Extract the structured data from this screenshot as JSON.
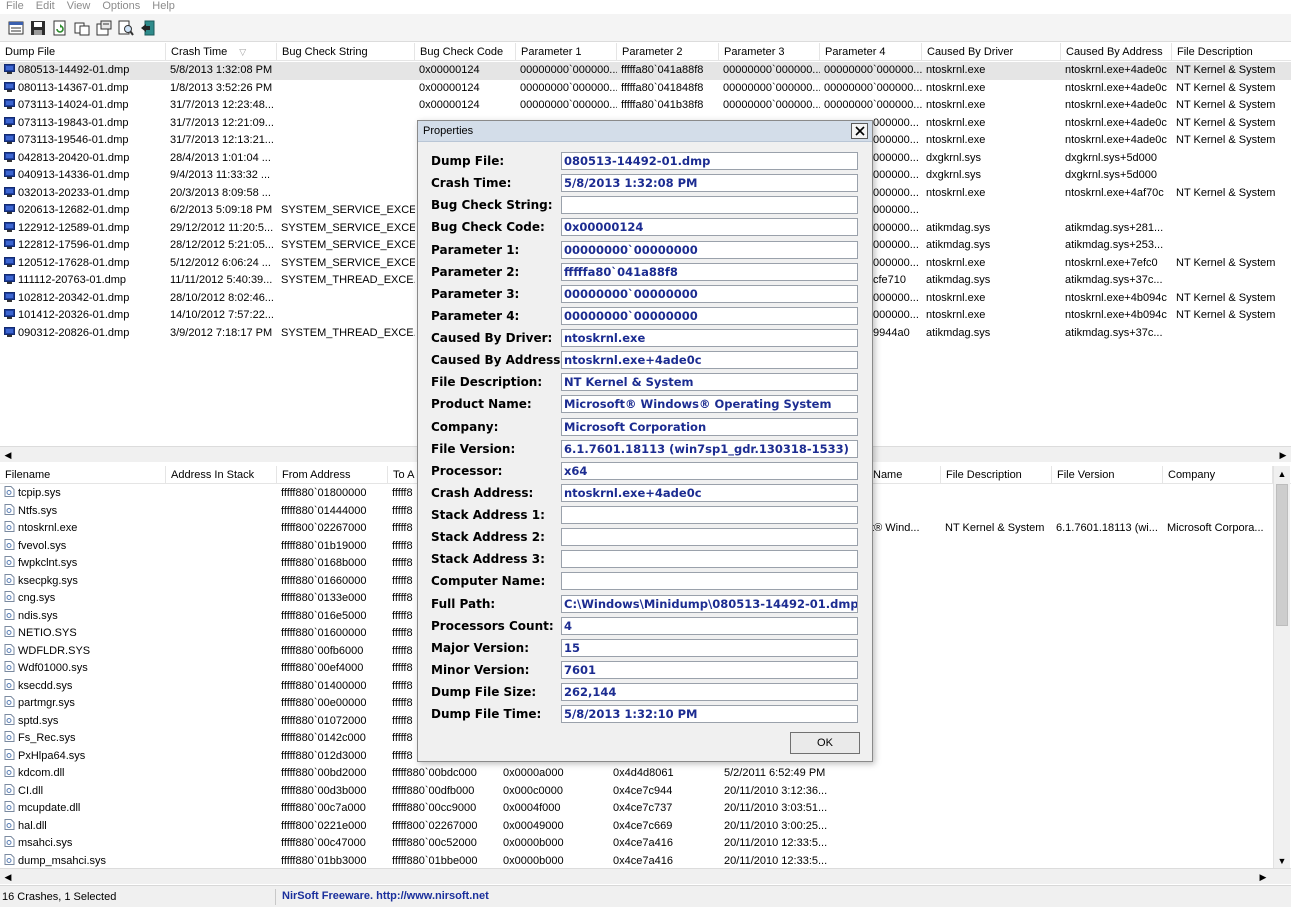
{
  "menu": [
    "File",
    "Edit",
    "View",
    "Options",
    "Help"
  ],
  "toolbar": {
    "icons": [
      "properties-icon",
      "save-icon",
      "refresh-icon",
      "copy-icon",
      "html-report-icon",
      "find-icon",
      "exit-icon"
    ]
  },
  "top_table": {
    "columns": [
      "Dump File",
      "Crash Time",
      "Bug Check String",
      "Bug Check Code",
      "Parameter 1",
      "Parameter 2",
      "Parameter 3",
      "Parameter 4",
      "Caused By Driver",
      "Caused By Address",
      "File Description"
    ],
    "sort_column": "Crash Time",
    "rows": [
      [
        "080513-14492-01.dmp",
        "5/8/2013 1:32:08 PM",
        "",
        "0x00000124",
        "00000000`000000...",
        "fffffa80`041a88f8",
        "00000000`000000...",
        "00000000`000000...",
        "ntoskrnl.exe",
        "ntoskrnl.exe+4ade0c",
        "NT Kernel & System"
      ],
      [
        "080113-14367-01.dmp",
        "1/8/2013 3:52:26 PM",
        "",
        "0x00000124",
        "00000000`000000...",
        "fffffa80`041848f8",
        "00000000`000000...",
        "00000000`000000...",
        "ntoskrnl.exe",
        "ntoskrnl.exe+4ade0c",
        "NT Kernel & System"
      ],
      [
        "073113-14024-01.dmp",
        "31/7/2013 12:23:48...",
        "",
        "0x00000124",
        "00000000`000000...",
        "fffffa80`041b38f8",
        "00000000`000000...",
        "00000000`000000...",
        "ntoskrnl.exe",
        "ntoskrnl.exe+4ade0c",
        "NT Kernel & System"
      ],
      [
        "073113-19843-01.dmp",
        "31/7/2013 12:21:09...",
        "",
        "",
        "",
        "",
        "",
        "000000...",
        "ntoskrnl.exe",
        "ntoskrnl.exe+4ade0c",
        "NT Kernel & System"
      ],
      [
        "073113-19546-01.dmp",
        "31/7/2013 12:13:21...",
        "",
        "",
        "",
        "",
        "",
        "000000...",
        "ntoskrnl.exe",
        "ntoskrnl.exe+4ade0c",
        "NT Kernel & System"
      ],
      [
        "042813-20420-01.dmp",
        "28/4/2013 1:01:04 ...",
        "",
        "",
        "",
        "",
        "",
        "000000...",
        "dxgkrnl.sys",
        "dxgkrnl.sys+5d000",
        ""
      ],
      [
        "040913-14336-01.dmp",
        "9/4/2013 11:33:32 ...",
        "",
        "",
        "",
        "",
        "",
        "000000...",
        "dxgkrnl.sys",
        "dxgkrnl.sys+5d000",
        ""
      ],
      [
        "032013-20233-01.dmp",
        "20/3/2013 8:09:58 ...",
        "",
        "",
        "",
        "",
        "",
        "000000...",
        "ntoskrnl.exe",
        "ntoskrnl.exe+4af70c",
        "NT Kernel & System"
      ],
      [
        "020613-12682-01.dmp",
        "6/2/2013 5:09:18 PM",
        "SYSTEM_SERVICE_EXCE...",
        "",
        "",
        "",
        "",
        "000000...",
        "",
        "",
        ""
      ],
      [
        "122912-12589-01.dmp",
        "29/12/2012 11:20:5...",
        "SYSTEM_SERVICE_EXCE...",
        "",
        "",
        "",
        "",
        "000000...",
        "atikmdag.sys",
        "atikmdag.sys+281...",
        ""
      ],
      [
        "122812-17596-01.dmp",
        "28/12/2012 5:21:05...",
        "SYSTEM_SERVICE_EXCE...",
        "",
        "",
        "",
        "",
        "000000...",
        "atikmdag.sys",
        "atikmdag.sys+253...",
        ""
      ],
      [
        "120512-17628-01.dmp",
        "5/12/2012 6:06:24 ...",
        "SYSTEM_SERVICE_EXCE...",
        "",
        "",
        "",
        "",
        "000000...",
        "ntoskrnl.exe",
        "ntoskrnl.exe+7efc0",
        "NT Kernel & System"
      ],
      [
        "111112-20763-01.dmp",
        "11/11/2012 5:40:39...",
        "SYSTEM_THREAD_EXCE...",
        "",
        "",
        "",
        "",
        "cfe710",
        "atikmdag.sys",
        "atikmdag.sys+37c...",
        ""
      ],
      [
        "102812-20342-01.dmp",
        "28/10/2012 8:02:46...",
        "",
        "",
        "",
        "",
        "",
        "000000...",
        "ntoskrnl.exe",
        "ntoskrnl.exe+4b094c",
        "NT Kernel & System"
      ],
      [
        "101412-20326-01.dmp",
        "14/10/2012 7:57:22...",
        "",
        "",
        "",
        "",
        "",
        "000000...",
        "ntoskrnl.exe",
        "ntoskrnl.exe+4b094c",
        "NT Kernel & System"
      ],
      [
        "090312-20826-01.dmp",
        "3/9/2012 7:18:17 PM",
        "SYSTEM_THREAD_EXCE...",
        "",
        "",
        "",
        "",
        "9944a0",
        "atikmdag.sys",
        "atikmdag.sys+37c...",
        ""
      ]
    ]
  },
  "bottom_table": {
    "columns": [
      "Filename",
      "Address In Stack",
      "From Address",
      "To A",
      "",
      "",
      "",
      "Name",
      "File Description",
      "File Version",
      "Company"
    ],
    "rows": [
      [
        "tcpip.sys",
        "",
        "fffff880`01800000",
        "fffff8",
        "",
        "",
        "",
        "",
        "",
        "",
        ""
      ],
      [
        "Ntfs.sys",
        "",
        "fffff880`01444000",
        "fffff8",
        "",
        "",
        "",
        "",
        "",
        "",
        ""
      ],
      [
        "ntoskrnl.exe",
        "",
        "fffff800`02267000",
        "fffff8",
        "",
        "",
        "",
        "ft® Wind...",
        "NT Kernel & System",
        "6.1.7601.18113 (wi...",
        "Microsoft Corpora..."
      ],
      [
        "fvevol.sys",
        "",
        "fffff880`01b19000",
        "fffff8",
        "",
        "",
        "",
        "",
        "",
        "",
        ""
      ],
      [
        "fwpkclnt.sys",
        "",
        "fffff880`0168b000",
        "fffff8",
        "",
        "",
        "",
        "",
        "",
        "",
        ""
      ],
      [
        "ksecpkg.sys",
        "",
        "fffff880`01660000",
        "fffff8",
        "",
        "",
        "",
        "",
        "",
        "",
        ""
      ],
      [
        "cng.sys",
        "",
        "fffff880`0133e000",
        "fffff8",
        "",
        "",
        "",
        "",
        "",
        "",
        ""
      ],
      [
        "ndis.sys",
        "",
        "fffff880`016e5000",
        "fffff8",
        "",
        "",
        "",
        "",
        "",
        "",
        ""
      ],
      [
        "NETIO.SYS",
        "",
        "fffff880`01600000",
        "fffff8",
        "",
        "",
        "",
        "",
        "",
        "",
        ""
      ],
      [
        "WDFLDR.SYS",
        "",
        "fffff880`00fb6000",
        "fffff8",
        "",
        "",
        "",
        "",
        "",
        "",
        ""
      ],
      [
        "Wdf01000.sys",
        "",
        "fffff880`00ef4000",
        "fffff8",
        "",
        "",
        "",
        "",
        "",
        "",
        ""
      ],
      [
        "ksecdd.sys",
        "",
        "fffff880`01400000",
        "fffff8",
        "",
        "",
        "",
        "",
        "",
        "",
        ""
      ],
      [
        "partmgr.sys",
        "",
        "fffff880`00e00000",
        "fffff8",
        "",
        "",
        "",
        "",
        "",
        "",
        ""
      ],
      [
        "sptd.sys",
        "",
        "fffff880`01072000",
        "fffff8",
        "",
        "",
        "",
        "",
        "",
        "",
        ""
      ],
      [
        "Fs_Rec.sys",
        "",
        "fffff880`0142c000",
        "fffff8",
        "",
        "",
        "",
        "",
        "",
        "",
        ""
      ],
      [
        "PxHlpa64.sys",
        "",
        "fffff880`012d3000",
        "fffff8",
        "",
        "",
        "",
        "",
        "",
        "",
        ""
      ],
      [
        "kdcom.dll",
        "",
        "fffff880`00bd2000",
        "fffff880`00bdc000",
        "0x0000a000",
        "0x4d4d8061",
        "5/2/2011 6:52:49 PM",
        "",
        "",
        "",
        ""
      ],
      [
        "CI.dll",
        "",
        "fffff880`00d3b000",
        "fffff880`00dfb000",
        "0x000c0000",
        "0x4ce7c944",
        "20/11/2010 3:12:36...",
        "",
        "",
        "",
        ""
      ],
      [
        "mcupdate.dll",
        "",
        "fffff880`00c7a000",
        "fffff880`00cc9000",
        "0x0004f000",
        "0x4ce7c737",
        "20/11/2010 3:03:51...",
        "",
        "",
        "",
        ""
      ],
      [
        "hal.dll",
        "",
        "fffff800`0221e000",
        "fffff800`02267000",
        "0x00049000",
        "0x4ce7c669",
        "20/11/2010 3:00:25...",
        "",
        "",
        "",
        ""
      ],
      [
        "msahci.sys",
        "",
        "fffff880`00c47000",
        "fffff880`00c52000",
        "0x0000b000",
        "0x4ce7a416",
        "20/11/2010 12:33:5...",
        "",
        "",
        "",
        ""
      ],
      [
        "dump_msahci.sys",
        "",
        "fffff880`01bb3000",
        "fffff880`01bbe000",
        "0x0000b000",
        "0x4ce7a416",
        "20/11/2010 12:33:5...",
        "",
        "",
        "",
        ""
      ]
    ]
  },
  "status": {
    "count": "16 Crashes, 1 Selected",
    "link": "NirSoft Freeware.  http://www.nirsoft.net"
  },
  "dialog": {
    "title": "Properties",
    "ok_label": "OK",
    "fields": [
      {
        "label": "Dump File:",
        "value": "080513-14492-01.dmp"
      },
      {
        "label": "Crash Time:",
        "value": "5/8/2013 1:32:08 PM"
      },
      {
        "label": "Bug Check String:",
        "value": ""
      },
      {
        "label": "Bug Check Code:",
        "value": "0x00000124"
      },
      {
        "label": "Parameter 1:",
        "value": "00000000`00000000"
      },
      {
        "label": "Parameter 2:",
        "value": "fffffa80`041a88f8"
      },
      {
        "label": "Parameter 3:",
        "value": "00000000`00000000"
      },
      {
        "label": "Parameter 4:",
        "value": "00000000`00000000"
      },
      {
        "label": "Caused By Driver:",
        "value": "ntoskrnl.exe"
      },
      {
        "label": "Caused By Address:",
        "value": "ntoskrnl.exe+4ade0c"
      },
      {
        "label": "File Description:",
        "value": "NT Kernel & System"
      },
      {
        "label": "Product Name:",
        "value": "Microsoft® Windows® Operating System"
      },
      {
        "label": "Company:",
        "value": "Microsoft Corporation"
      },
      {
        "label": "File Version:",
        "value": "6.1.7601.18113 (win7sp1_gdr.130318-1533)"
      },
      {
        "label": "Processor:",
        "value": "x64"
      },
      {
        "label": "Crash Address:",
        "value": "ntoskrnl.exe+4ade0c"
      },
      {
        "label": "Stack Address 1:",
        "value": ""
      },
      {
        "label": "Stack Address 2:",
        "value": ""
      },
      {
        "label": "Stack Address 3:",
        "value": ""
      },
      {
        "label": "Computer Name:",
        "value": ""
      },
      {
        "label": "Full Path:",
        "value": "C:\\Windows\\Minidump\\080513-14492-01.dmp"
      },
      {
        "label": "Processors Count:",
        "value": "4"
      },
      {
        "label": "Major Version:",
        "value": "15"
      },
      {
        "label": "Minor Version:",
        "value": "7601"
      },
      {
        "label": "Dump File Size:",
        "value": "262,144"
      },
      {
        "label": "Dump File Time:",
        "value": "5/8/2013 1:32:10 PM"
      }
    ]
  },
  "colors": {
    "dialog_value_text": "#1c2c91",
    "status_link": "#1a2f9c",
    "menu_disabled": "#8c8c8c",
    "selected_row": "#e5e5e5"
  }
}
